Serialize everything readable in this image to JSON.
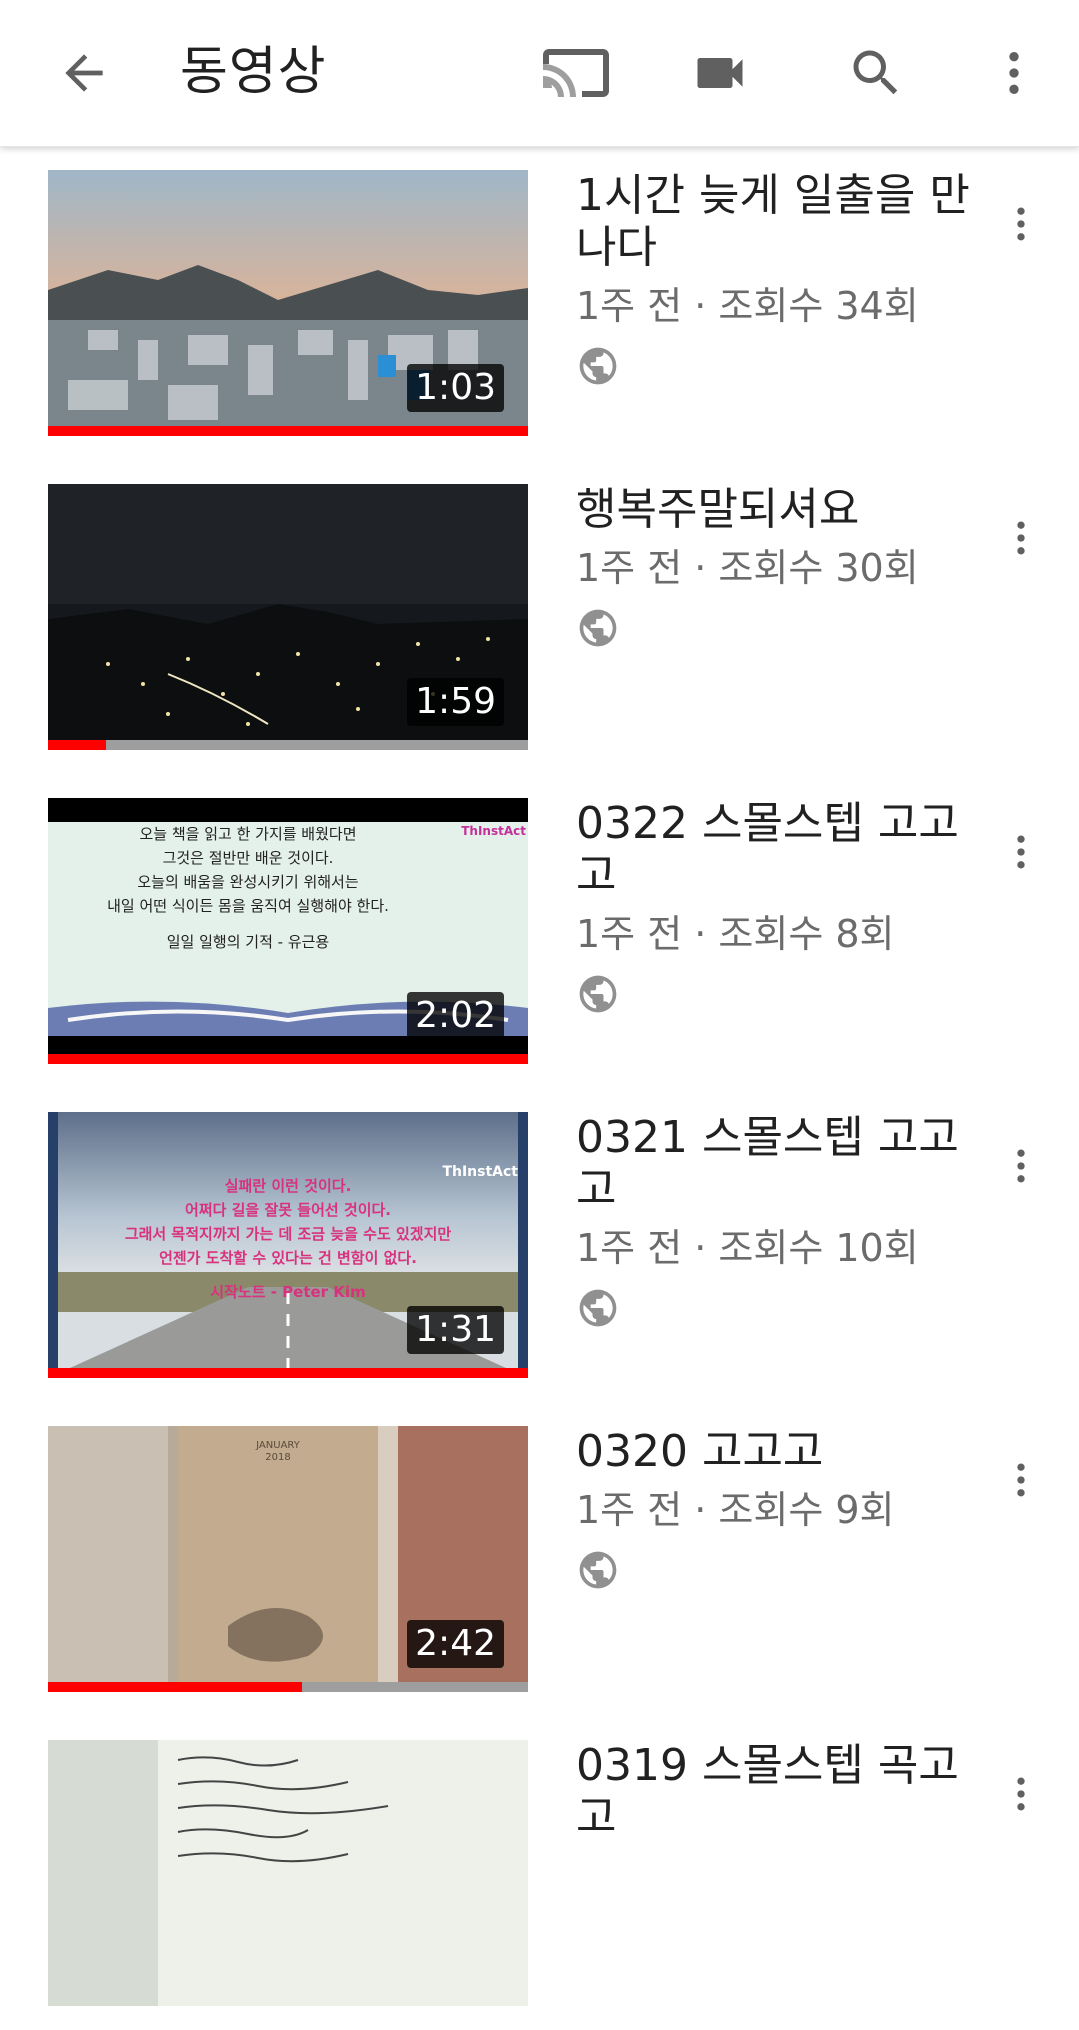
{
  "appbar": {
    "title": "동영상",
    "icons": {
      "back": "arrow-back-icon",
      "cast": "cast-icon",
      "camera": "video-camera-icon",
      "search": "search-icon",
      "more": "more-vert-icon"
    }
  },
  "colors": {
    "accent": "#ff0000",
    "text_primary": "#212121",
    "text_secondary": "#6b6b6b",
    "icon": "#606060"
  },
  "videos": [
    {
      "title": "1시간 늦게 일출을 만나다",
      "sub": "1주 전 · 조회수 34회",
      "duration": "1:03",
      "watched_fraction": 1.0,
      "visibility_icon": "public-globe-icon"
    },
    {
      "title": "행복주말되셔요",
      "sub": "1주 전 · 조회수 30회",
      "duration": "1:59",
      "watched_fraction": 0.12,
      "visibility_icon": "public-globe-icon"
    },
    {
      "title": "0322 스몰스텝 고고고",
      "sub": "1주 전 · 조회수 8회",
      "duration": "2:02",
      "watched_fraction": 1.0,
      "visibility_icon": "public-globe-icon",
      "thumb_text": [
        "오늘 책을 읽고 한 가지를 배웠다면",
        "그것은 절반만 배운 것이다.",
        "오늘의 배움을 완성시키기 위해서는",
        "내일 어떤 식이든 몸을 움직여 실행해야 한다.",
        "일일 일행의 기적 - 유근용"
      ],
      "thumb_logo": "ThInstAct"
    },
    {
      "title": "0321 스몰스텝 고고고",
      "sub": "1주 전 · 조회수 10회",
      "duration": "1:31",
      "watched_fraction": 1.0,
      "visibility_icon": "public-globe-icon",
      "thumb_text": [
        "실패란 이런 것이다.",
        "어쩌다 길을 잘못 들어선 것이다.",
        "그래서 목적지까지 가는 데 조금 늦을 수도 있겠지만",
        "언젠가 도착할 수 있다는 건 변함이 없다.",
        "시작노트 - Peter Kim"
      ],
      "thumb_logo": "ThInstAct"
    },
    {
      "title": "0320 고고고",
      "sub": "1주 전 · 조회수 9회",
      "duration": "2:42",
      "watched_fraction": 0.53,
      "visibility_icon": "public-globe-icon",
      "thumb_text": [
        "JANUARY",
        "2018"
      ]
    },
    {
      "title": "0319 스몰스텝 곡고고",
      "sub": "",
      "duration": "",
      "watched_fraction": 0,
      "visibility_icon": "public-globe-icon"
    }
  ]
}
